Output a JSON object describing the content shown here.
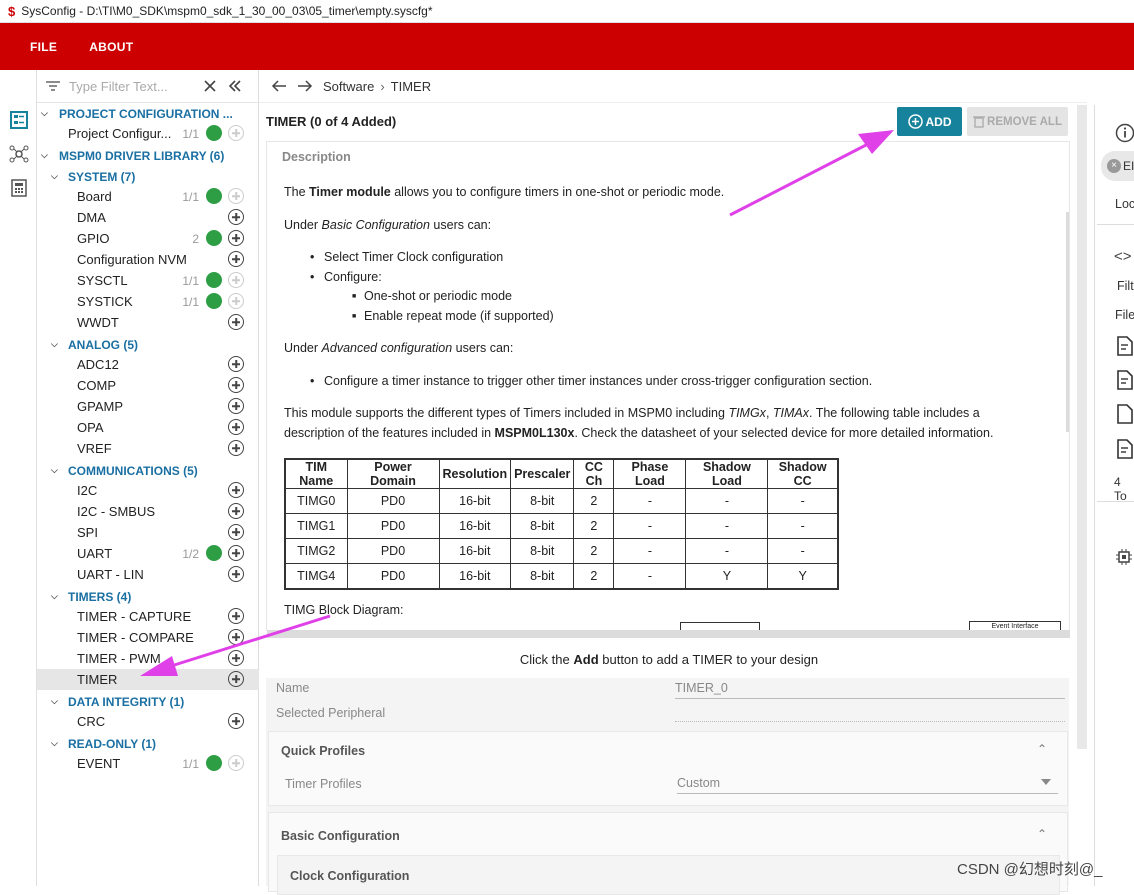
{
  "window": {
    "title": "SysConfig - D:\\TI\\M0_SDK\\mspm0_sdk_1_30_00_03\\05_timer\\empty.syscfg*"
  },
  "menu": {
    "file": "FILE",
    "about": "ABOUT"
  },
  "filter": {
    "placeholder": "Type Filter Text..."
  },
  "tree": {
    "project_config": "PROJECT CONFIGURATION ...",
    "project_config_item": "Project Configur...",
    "project_config_count": "1/1",
    "driver_library": "MSPM0 DRIVER LIBRARY (6)",
    "system": "SYSTEM (7)",
    "board": "Board",
    "board_count": "1/1",
    "dma": "DMA",
    "gpio": "GPIO",
    "gpio_count": "2",
    "config_nvm": "Configuration NVM",
    "sysctl": "SYSCTL",
    "sysctl_count": "1/1",
    "systick": "SYSTICK",
    "systick_count": "1/1",
    "wwdt": "WWDT",
    "analog": "ANALOG (5)",
    "adc12": "ADC12",
    "comp": "COMP",
    "gpamp": "GPAMP",
    "opa": "OPA",
    "vref": "VREF",
    "communications": "COMMUNICATIONS (5)",
    "i2c": "I2C",
    "i2c_smbus": "I2C - SMBUS",
    "spi": "SPI",
    "uart": "UART",
    "uart_count": "1/2",
    "uart_lin": "UART - LIN",
    "timers": "TIMERS (4)",
    "timer_capture": "TIMER - CAPTURE",
    "timer_compare": "TIMER - COMPARE",
    "timer_pwm": "TIMER - PWM",
    "timer": "TIMER",
    "data_integrity": "DATA INTEGRITY (1)",
    "crc": "CRC",
    "read_only": "READ-ONLY (1)",
    "event": "EVENT",
    "event_count": "1/1"
  },
  "breadcrumb": {
    "software": "Software",
    "timer": "TIMER"
  },
  "module": {
    "title": "TIMER (0 of 4 Added)",
    "add": "ADD",
    "remove_all": "REMOVE ALL",
    "description_heading": "Description",
    "intro_pre": "The ",
    "intro_bold": "Timer module",
    "intro_post": " allows you to configure timers in one-shot or periodic mode.",
    "basic_pre": "Under ",
    "basic_em": "Basic Configuration",
    "basic_post": " users can:",
    "b1": "Select Timer Clock configuration",
    "b2": "Configure:",
    "b2a": "One-shot or periodic mode",
    "b2b": "Enable repeat mode (if supported)",
    "adv_pre": "Under ",
    "adv_em": "Advanced configuration",
    "adv_post": " users can:",
    "a1": "Configure a timer instance to trigger other timer instances under cross-trigger configuration section.",
    "support1_pre": "This module supports the different types of Timers included in MSPM0 including ",
    "support1_em1": "TIMGx",
    "support1_mid": ", ",
    "support1_em2": "TIMAx",
    "support1_post": ". The following table includes a",
    "support2_pre": "description of the features included in ",
    "support2_bold": "MSPM0L130x",
    "support2_post": ". Check the datasheet of your selected device for more detailed information.",
    "table_headers": [
      "TIM Name",
      "Power Domain",
      "Resolution",
      "Prescaler",
      "CC Ch",
      "Phase Load",
      "Shadow Load",
      "Shadow CC"
    ],
    "table_rows": [
      [
        "TIMG0",
        "PD0",
        "16-bit",
        "8-bit",
        "2",
        "-",
        "-",
        "-"
      ],
      [
        "TIMG1",
        "PD0",
        "16-bit",
        "8-bit",
        "2",
        "-",
        "-",
        "-"
      ],
      [
        "TIMG2",
        "PD0",
        "16-bit",
        "8-bit",
        "2",
        "-",
        "-",
        "-"
      ],
      [
        "TIMG4",
        "PD0",
        "16-bit",
        "8-bit",
        "2",
        "-",
        "Y",
        "Y"
      ]
    ],
    "block_diagram": "TIMG Block Diagram:",
    "diagram_label": "Event Interface",
    "hint_pre": "Click the ",
    "hint_bold": "Add",
    "hint_post": " button to add a TIMER to your design"
  },
  "properties": {
    "name_label": "Name",
    "name_value": "TIMER_0",
    "periph_label": "Selected Peripheral",
    "quick_profiles": "Quick Profiles",
    "timer_profiles_label": "Timer Profiles",
    "timer_profiles_value": "Custom",
    "basic_configuration": "Basic Configuration",
    "clock_configuration": "Clock Configuration"
  },
  "right_pane": {
    "chip": "EI",
    "loc": "Loc",
    "filt": "Filt",
    "file": "File",
    "count": "4 To"
  },
  "watermark": "CSDN @幻想时刻@_",
  "colors": {
    "menubar": "#cc0000",
    "accent": "#17829c",
    "category": "#1a6fa3",
    "ok": "#2e9e44",
    "arrow": "#e040e8"
  }
}
